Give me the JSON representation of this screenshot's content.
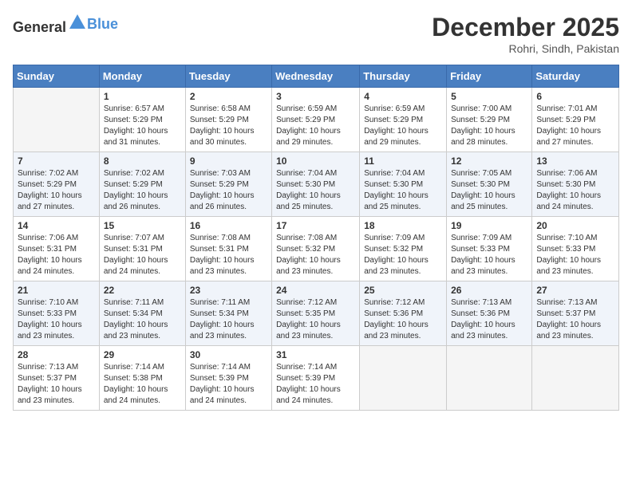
{
  "header": {
    "logo": {
      "text_general": "General",
      "text_blue": "Blue"
    },
    "title": "December 2025",
    "location": "Rohri, Sindh, Pakistan"
  },
  "calendar": {
    "weekdays": [
      "Sunday",
      "Monday",
      "Tuesday",
      "Wednesday",
      "Thursday",
      "Friday",
      "Saturday"
    ],
    "weeks": [
      [
        {
          "day": "",
          "empty": true
        },
        {
          "day": "1",
          "sunrise": "6:57 AM",
          "sunset": "5:29 PM",
          "daylight": "10 hours and 31 minutes."
        },
        {
          "day": "2",
          "sunrise": "6:58 AM",
          "sunset": "5:29 PM",
          "daylight": "10 hours and 30 minutes."
        },
        {
          "day": "3",
          "sunrise": "6:59 AM",
          "sunset": "5:29 PM",
          "daylight": "10 hours and 29 minutes."
        },
        {
          "day": "4",
          "sunrise": "6:59 AM",
          "sunset": "5:29 PM",
          "daylight": "10 hours and 29 minutes."
        },
        {
          "day": "5",
          "sunrise": "7:00 AM",
          "sunset": "5:29 PM",
          "daylight": "10 hours and 28 minutes."
        },
        {
          "day": "6",
          "sunrise": "7:01 AM",
          "sunset": "5:29 PM",
          "daylight": "10 hours and 27 minutes."
        }
      ],
      [
        {
          "day": "7",
          "sunrise": "7:02 AM",
          "sunset": "5:29 PM",
          "daylight": "10 hours and 27 minutes."
        },
        {
          "day": "8",
          "sunrise": "7:02 AM",
          "sunset": "5:29 PM",
          "daylight": "10 hours and 26 minutes."
        },
        {
          "day": "9",
          "sunrise": "7:03 AM",
          "sunset": "5:29 PM",
          "daylight": "10 hours and 26 minutes."
        },
        {
          "day": "10",
          "sunrise": "7:04 AM",
          "sunset": "5:30 PM",
          "daylight": "10 hours and 25 minutes."
        },
        {
          "day": "11",
          "sunrise": "7:04 AM",
          "sunset": "5:30 PM",
          "daylight": "10 hours and 25 minutes."
        },
        {
          "day": "12",
          "sunrise": "7:05 AM",
          "sunset": "5:30 PM",
          "daylight": "10 hours and 25 minutes."
        },
        {
          "day": "13",
          "sunrise": "7:06 AM",
          "sunset": "5:30 PM",
          "daylight": "10 hours and 24 minutes."
        }
      ],
      [
        {
          "day": "14",
          "sunrise": "7:06 AM",
          "sunset": "5:31 PM",
          "daylight": "10 hours and 24 minutes."
        },
        {
          "day": "15",
          "sunrise": "7:07 AM",
          "sunset": "5:31 PM",
          "daylight": "10 hours and 24 minutes."
        },
        {
          "day": "16",
          "sunrise": "7:08 AM",
          "sunset": "5:31 PM",
          "daylight": "10 hours and 23 minutes."
        },
        {
          "day": "17",
          "sunrise": "7:08 AM",
          "sunset": "5:32 PM",
          "daylight": "10 hours and 23 minutes."
        },
        {
          "day": "18",
          "sunrise": "7:09 AM",
          "sunset": "5:32 PM",
          "daylight": "10 hours and 23 minutes."
        },
        {
          "day": "19",
          "sunrise": "7:09 AM",
          "sunset": "5:33 PM",
          "daylight": "10 hours and 23 minutes."
        },
        {
          "day": "20",
          "sunrise": "7:10 AM",
          "sunset": "5:33 PM",
          "daylight": "10 hours and 23 minutes."
        }
      ],
      [
        {
          "day": "21",
          "sunrise": "7:10 AM",
          "sunset": "5:33 PM",
          "daylight": "10 hours and 23 minutes."
        },
        {
          "day": "22",
          "sunrise": "7:11 AM",
          "sunset": "5:34 PM",
          "daylight": "10 hours and 23 minutes."
        },
        {
          "day": "23",
          "sunrise": "7:11 AM",
          "sunset": "5:34 PM",
          "daylight": "10 hours and 23 minutes."
        },
        {
          "day": "24",
          "sunrise": "7:12 AM",
          "sunset": "5:35 PM",
          "daylight": "10 hours and 23 minutes."
        },
        {
          "day": "25",
          "sunrise": "7:12 AM",
          "sunset": "5:36 PM",
          "daylight": "10 hours and 23 minutes."
        },
        {
          "day": "26",
          "sunrise": "7:13 AM",
          "sunset": "5:36 PM",
          "daylight": "10 hours and 23 minutes."
        },
        {
          "day": "27",
          "sunrise": "7:13 AM",
          "sunset": "5:37 PM",
          "daylight": "10 hours and 23 minutes."
        }
      ],
      [
        {
          "day": "28",
          "sunrise": "7:13 AM",
          "sunset": "5:37 PM",
          "daylight": "10 hours and 23 minutes."
        },
        {
          "day": "29",
          "sunrise": "7:14 AM",
          "sunset": "5:38 PM",
          "daylight": "10 hours and 24 minutes."
        },
        {
          "day": "30",
          "sunrise": "7:14 AM",
          "sunset": "5:39 PM",
          "daylight": "10 hours and 24 minutes."
        },
        {
          "day": "31",
          "sunrise": "7:14 AM",
          "sunset": "5:39 PM",
          "daylight": "10 hours and 24 minutes."
        },
        {
          "day": "",
          "empty": true
        },
        {
          "day": "",
          "empty": true
        },
        {
          "day": "",
          "empty": true
        }
      ]
    ]
  }
}
